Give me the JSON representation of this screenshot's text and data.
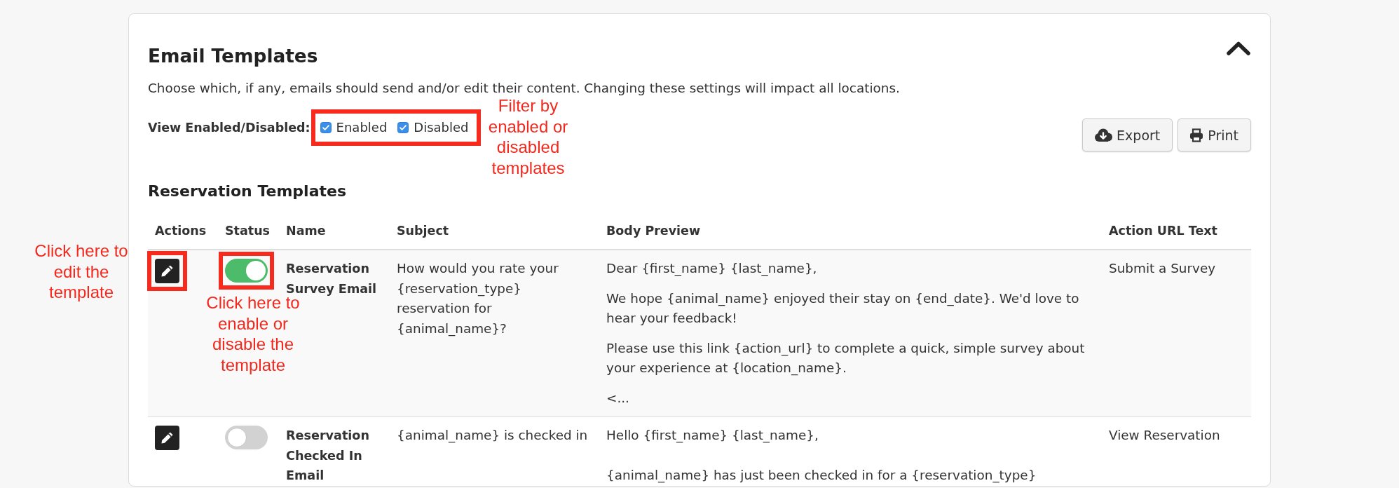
{
  "panel": {
    "title": "Email Templates",
    "expanded": true,
    "description": "Choose which, if any, emails should send and/or edit their content. Changing these settings will impact all locations."
  },
  "filters": {
    "label": "View Enabled/Disabled:",
    "highlighted": true,
    "callout": "Filter by enabled or disabled templates",
    "options": [
      {
        "label": "Enabled",
        "checked": true
      },
      {
        "label": "Disabled",
        "checked": true
      }
    ]
  },
  "toolbar": {
    "buttons": [
      {
        "label": "Export",
        "kind": "export"
      },
      {
        "label": "Print",
        "kind": "print"
      }
    ]
  },
  "section_title": "Reservation Templates",
  "table": {
    "columns": [
      "Actions",
      "Status",
      "Name",
      "Subject",
      "Body Preview",
      "Action URL Text"
    ],
    "rows": [
      {
        "edit_highlighted": true,
        "edit_callout": "Click here to edit the template",
        "enabled": true,
        "toggle_highlighted": true,
        "toggle_callout": "Click here to enable or disable the template",
        "name": "Reservation Survey Email",
        "subject": "How would you rate your {reservation_type} reservation for {animal_name}?",
        "body": [
          "Dear {first_name} {last_name},",
          "We hope {animal_name} enjoyed their stay on {end_date}. We'd love to hear your feedback!",
          "Please use this link {action_url} to complete a quick, simple survey about your experience at {location_name}.",
          "<..."
        ],
        "action_url_text": "Submit a Survey"
      },
      {
        "edit_highlighted": false,
        "enabled": false,
        "toggle_highlighted": false,
        "name": "Reservation Checked In Email",
        "subject": "{animal_name} is checked in",
        "body": [
          "Hello {first_name} {last_name},\n\n{animal_name} has just been checked in for a {reservation_type}"
        ],
        "action_url_text": "View Reservation"
      }
    ]
  }
}
